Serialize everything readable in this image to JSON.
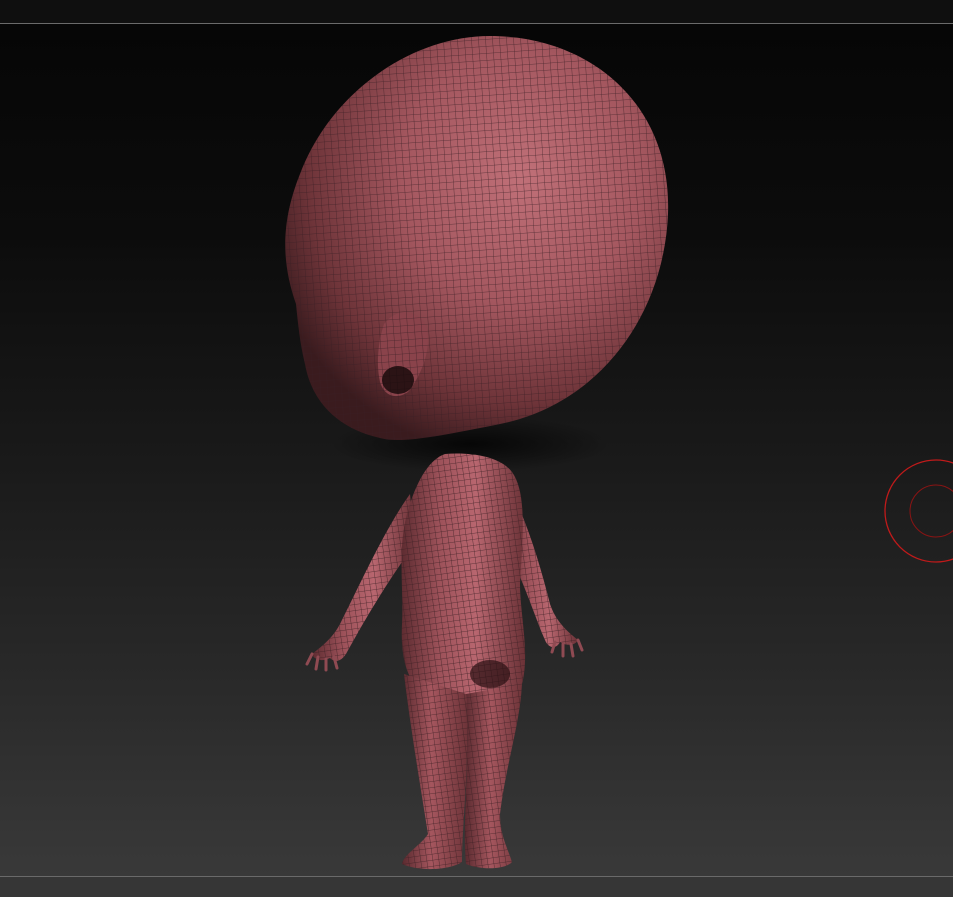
{
  "app": {
    "window": "3d-sculpting-viewport"
  },
  "viewport": {
    "background_top": "#060606",
    "background_bottom": "#393939",
    "model": {
      "name": "stylized-chibi-base-mesh",
      "material_color": "#a0545e",
      "wireframe_color": "#3a1f24",
      "view": "back-three-quarter"
    },
    "brush_cursor": {
      "color": "#c01a1a",
      "shape": "double-ring"
    }
  },
  "colors": {
    "frame_line": "#6a6a6a",
    "top_bar": "#0f0f0f",
    "bottom_bar": "#363636"
  }
}
